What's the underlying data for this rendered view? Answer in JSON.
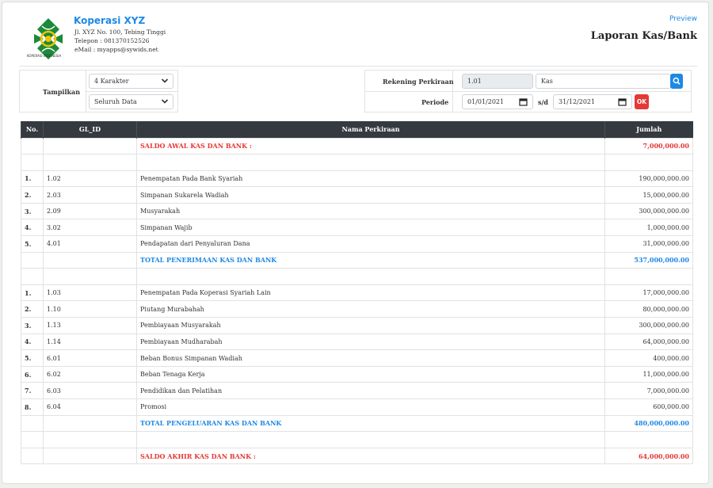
{
  "header": {
    "logo_caption": "KOPERASI INDONESIA",
    "org_name": "Koperasi XYZ",
    "address": "Jl. XYZ No. 100, Tebing Tinggi",
    "phone": "Telepon : 081370152526",
    "email": "eMail : myapps@sywids.net",
    "preview_label": "Preview",
    "report_title": "Laporan Kas/Bank"
  },
  "filters": {
    "tampilkan_label": "Tampilkan",
    "karakter_value": "4 Karakter",
    "data_value": "Seluruh Data",
    "rekening_label": "Rekening Perkiraan",
    "rekening_code": "1.01",
    "rekening_name": "Kas",
    "periode_label": "Periode",
    "date_from": "01/01/2021",
    "sd_label": "s/d",
    "date_to": "31/12/2021",
    "ok_label": "OK"
  },
  "colors": {
    "accent": "#1e88e5",
    "danger": "#e53935",
    "table_header": "#343a40"
  },
  "table": {
    "headers": [
      "No.",
      "GL_ID",
      "Nama Perkiraan",
      "Jumlah"
    ],
    "rows": [
      {
        "no": "",
        "gl": "",
        "name": "SALDO AWAL KAS DAN BANK :",
        "amount": "7,000,000.00",
        "style": "red"
      },
      {
        "no": "",
        "gl": "",
        "name": "",
        "amount": "",
        "style": ""
      },
      {
        "no": "1.",
        "gl": "1.02",
        "name": "Penempatan Pada Bank Syariah",
        "amount": "190,000,000.00",
        "style": ""
      },
      {
        "no": "2.",
        "gl": "2.03",
        "name": "Simpanan Sukarela Wadiah",
        "amount": "15,000,000.00",
        "style": ""
      },
      {
        "no": "3.",
        "gl": "2.09",
        "name": "Musyarakah",
        "amount": "300,000,000.00",
        "style": ""
      },
      {
        "no": "4.",
        "gl": "3.02",
        "name": "Simpanan Wajib",
        "amount": "1,000,000.00",
        "style": ""
      },
      {
        "no": "5.",
        "gl": "4.01",
        "name": "Pendapatan dari Penyaluran Dana",
        "amount": "31,000,000.00",
        "style": ""
      },
      {
        "no": "",
        "gl": "",
        "name": "TOTAL PENERIMAAN KAS DAN BANK",
        "amount": "537,000,000.00",
        "style": "blue"
      },
      {
        "no": "",
        "gl": "",
        "name": "",
        "amount": "",
        "style": ""
      },
      {
        "no": "1.",
        "gl": "1.03",
        "name": "Penempatan Pada Koperasi Syariah Lain",
        "amount": "17,000,000.00",
        "style": ""
      },
      {
        "no": "2.",
        "gl": "1.10",
        "name": "Piutang Murabahah",
        "amount": "80,000,000.00",
        "style": ""
      },
      {
        "no": "3.",
        "gl": "1.13",
        "name": "Pembiayaan Musyarakah",
        "amount": "300,000,000.00",
        "style": ""
      },
      {
        "no": "4.",
        "gl": "1.14",
        "name": "Pembiayaan Mudharabah",
        "amount": "64,000,000.00",
        "style": ""
      },
      {
        "no": "5.",
        "gl": "6.01",
        "name": "Beban Bonus Simpanan Wadiah",
        "amount": "400,000.00",
        "style": ""
      },
      {
        "no": "6.",
        "gl": "6.02",
        "name": "Beban Tenaga Kerja",
        "amount": "11,000,000.00",
        "style": ""
      },
      {
        "no": "7.",
        "gl": "6.03",
        "name": "Pendidikan dan Pelatihan",
        "amount": "7,000,000.00",
        "style": ""
      },
      {
        "no": "8.",
        "gl": "6.04",
        "name": "Promosi",
        "amount": "600,000.00",
        "style": ""
      },
      {
        "no": "",
        "gl": "",
        "name": "TOTAL PENGELUARAN KAS DAN BANK",
        "amount": "480,000,000.00",
        "style": "blue"
      },
      {
        "no": "",
        "gl": "",
        "name": "",
        "amount": "",
        "style": ""
      },
      {
        "no": "",
        "gl": "",
        "name": "SALDO AKHIR KAS DAN BANK :",
        "amount": "64,000,000.00",
        "style": "red"
      }
    ]
  }
}
